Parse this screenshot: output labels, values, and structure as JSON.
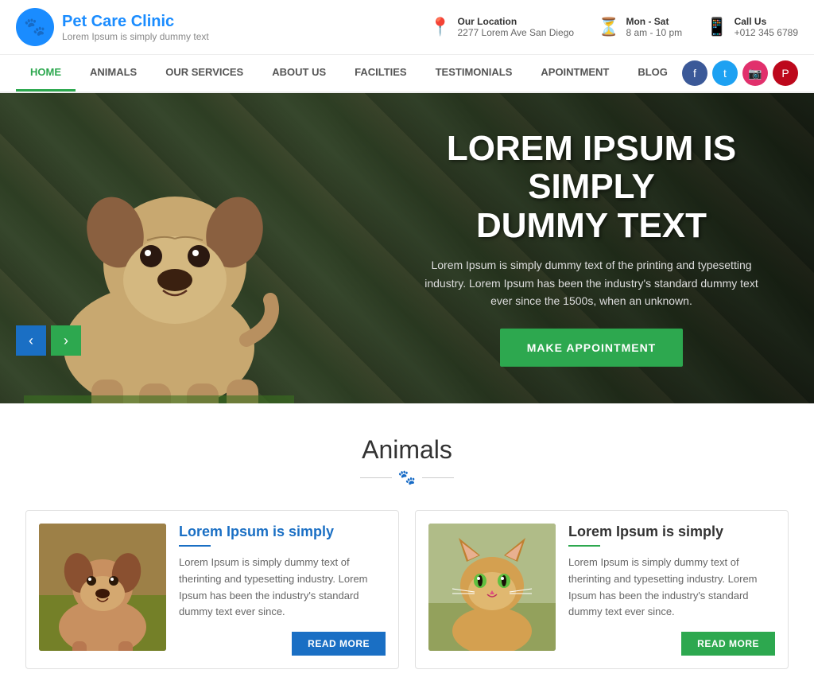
{
  "site": {
    "logo_icon": "🐾",
    "title": "Pet Care Clinic",
    "subtitle": "Lorem Ipsum is simply dummy text"
  },
  "topbar": {
    "location_label": "Our Location",
    "location_value": "2277 Lorem Ave San Diego",
    "hours_label": "Mon - Sat",
    "hours_value": "8 am - 10 pm",
    "call_label": "Call Us",
    "call_value": "+012 345 6789"
  },
  "nav": {
    "items": [
      {
        "label": "HOME",
        "active": true
      },
      {
        "label": "ANIMALS",
        "active": false
      },
      {
        "label": "OUR SERVICES",
        "active": false
      },
      {
        "label": "ABOUT US",
        "active": false
      },
      {
        "label": "FACILTIES",
        "active": false
      },
      {
        "label": "TESTIMONIALS",
        "active": false
      },
      {
        "label": "APOINTMENT",
        "active": false
      },
      {
        "label": "BLOG",
        "active": false
      }
    ]
  },
  "hero": {
    "title_line1": "LOREM IPSUM IS SIMPLY",
    "title_line2": "DUMMY TEXT",
    "description": "Lorem Ipsum is simply dummy text of the printing and typesetting industry. Lorem Ipsum has been the industry's standard dummy text ever since the 1500s, when an unknown.",
    "cta_button": "MAKE APPOINTMENT",
    "prev_label": "‹",
    "next_label": "›"
  },
  "animals_section": {
    "title": "Animals",
    "paw": "🐾",
    "card1": {
      "title": "Lorem Ipsum is simply",
      "description": "Lorem Ipsum is simply dummy text of therinting and typesetting industry. Lorem Ipsum has been the industry's standard dummy text ever since.",
      "button": "READ MORE"
    },
    "card2": {
      "title": "Lorem Ipsum is simply",
      "description": "Lorem Ipsum is simply dummy text of therinting and typesetting industry. Lorem Ipsum has been the industry's standard dummy text ever since.",
      "button": "READ MORE"
    }
  }
}
